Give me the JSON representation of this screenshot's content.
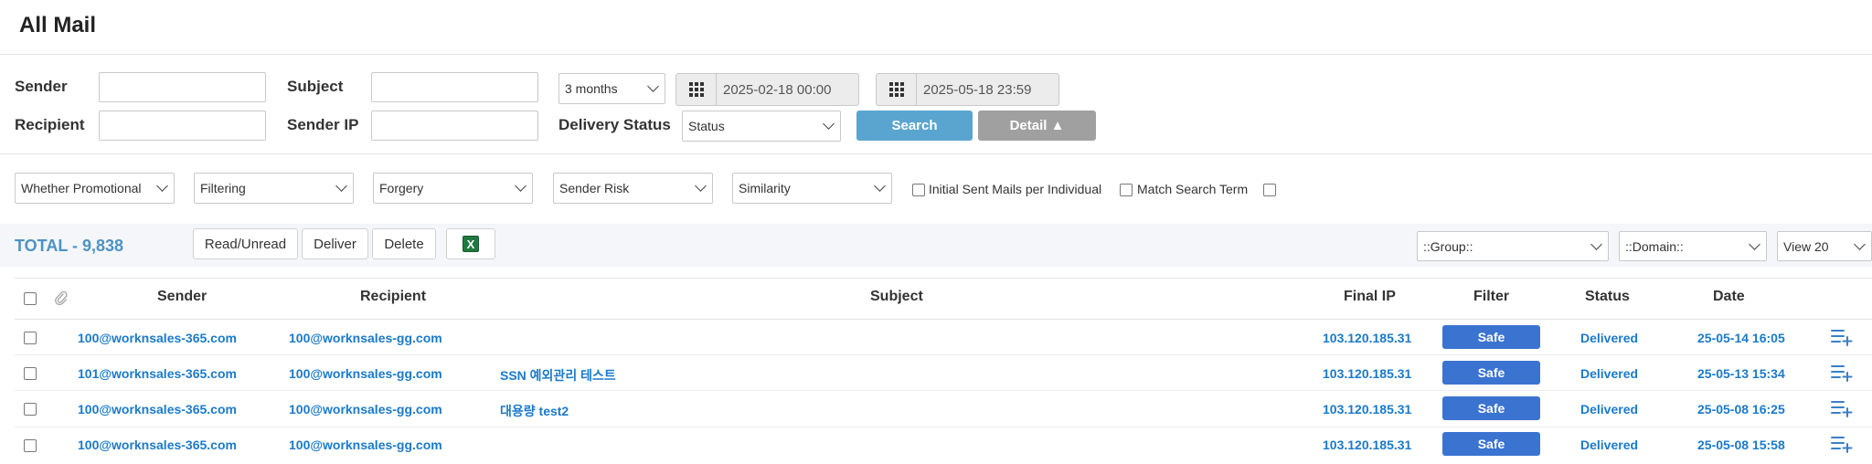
{
  "page": {
    "title": "All Mail"
  },
  "search": {
    "sender_label": "Sender",
    "subject_label": "Subject",
    "recipient_label": "Recipient",
    "sender_ip_label": "Sender IP",
    "delivery_status_label": "Delivery Status",
    "period": "3 months",
    "date_from": "2025-02-18 00:00",
    "date_to": "2025-05-18 23:59",
    "status": "Status",
    "search_button": "Search",
    "detail_button": "Detail ▲"
  },
  "filters": {
    "promotional": "Whether Promotional",
    "filtering": "Filtering",
    "forgery": "Forgery",
    "sender_risk": "Sender Risk",
    "similarity": "Similarity",
    "initial_sent": "Initial Sent Mails per Individual",
    "match_search": "Match Search Term"
  },
  "toolbar": {
    "total": "TOTAL - 9,838",
    "read_unread": "Read/Unread",
    "deliver": "Deliver",
    "delete": "Delete",
    "group": "::Group::",
    "domain": "::Domain::",
    "view": "View 20"
  },
  "table": {
    "headers": {
      "sender": "Sender",
      "recipient": "Recipient",
      "subject": "Subject",
      "final_ip": "Final IP",
      "filter": "Filter",
      "status": "Status",
      "date": "Date"
    },
    "rows": [
      {
        "sender": "100@worknsales-365.com",
        "recipient": "100@worknsales-gg.com",
        "subject": "",
        "final_ip": "103.120.185.31",
        "filter": "Safe",
        "status": "Delivered",
        "date": "25-05-14 16:05"
      },
      {
        "sender": "101@worknsales-365.com",
        "recipient": "100@worknsales-gg.com",
        "subject": "SSN 예외관리 테스트",
        "final_ip": "103.120.185.31",
        "filter": "Safe",
        "status": "Delivered",
        "date": "25-05-13 15:34"
      },
      {
        "sender": "100@worknsales-365.com",
        "recipient": "100@worknsales-gg.com",
        "subject": "대용량 test2",
        "final_ip": "103.120.185.31",
        "filter": "Safe",
        "status": "Delivered",
        "date": "25-05-08 16:25"
      },
      {
        "sender": "100@worknsales-365.com",
        "recipient": "100@worknsales-gg.com",
        "subject": "",
        "final_ip": "103.120.185.31",
        "filter": "Safe",
        "status": "Delivered",
        "date": "25-05-08 15:58"
      }
    ]
  }
}
